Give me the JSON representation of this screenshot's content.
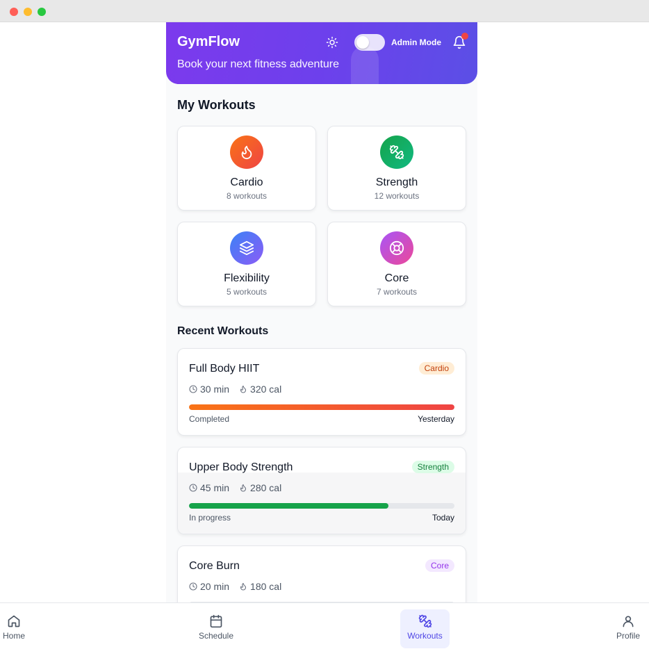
{
  "header": {
    "brand": "GymFlow",
    "tagline": "Book your next fitness adventure",
    "admin_label": "Admin Mode",
    "admin_enabled": false,
    "icons": [
      "sun-icon",
      "bell-icon"
    ],
    "gradient": [
      "#7c3aed",
      "#5b4fe6"
    ]
  },
  "my_workouts": {
    "title": "My Workouts",
    "categories": [
      {
        "name": "Cardio",
        "count": "8 workouts",
        "icon": "flame-icon",
        "color": "#f97316"
      },
      {
        "name": "Strength",
        "count": "12 workouts",
        "icon": "dumbbell-icon",
        "color": "#16a34a"
      },
      {
        "name": "Flexibility",
        "count": "5 workouts",
        "icon": "layers-icon",
        "color": "#6366f1"
      },
      {
        "name": "Core",
        "count": "7 workouts",
        "icon": "lifebuoy-icon",
        "color": "#c026d3"
      }
    ]
  },
  "recent": {
    "title": "Recent Workouts",
    "items": [
      {
        "title": "Full Body HIIT",
        "badge": "Cardio",
        "duration": "30 min",
        "calories": "320 cal",
        "progress": 1.0,
        "status": "Completed",
        "when": "Yesterday",
        "color": "#f97316"
      },
      {
        "title": "Upper Body Strength",
        "badge": "Strength",
        "duration": "45 min",
        "calories": "280 cal",
        "progress": 0.75,
        "status": "In progress",
        "when": "Today",
        "color": "#16a34a"
      },
      {
        "title": "Core Burn",
        "badge": "Core",
        "duration": "20 min",
        "calories": "180 cal",
        "color": "#c026d3"
      }
    ]
  },
  "nav": {
    "active": "Workouts",
    "items": [
      {
        "label": "Home",
        "icon": "home-icon"
      },
      {
        "label": "Schedule",
        "icon": "calendar-icon"
      },
      {
        "label": "Workouts",
        "icon": "dumbbell-icon"
      },
      {
        "label": "Profile",
        "icon": "user-icon"
      }
    ]
  }
}
